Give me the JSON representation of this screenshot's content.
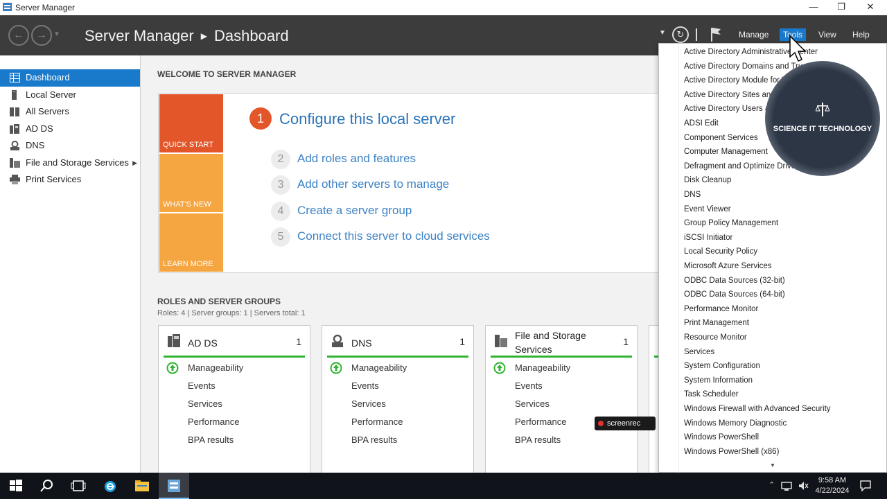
{
  "window": {
    "title": "Server Manager",
    "minimize_icon": "minimize-icon",
    "maximize_icon": "restore-icon",
    "close_icon": "close-icon"
  },
  "header": {
    "app_name": "Server Manager",
    "page": "Dashboard",
    "menus": [
      "Manage",
      "Tools",
      "View",
      "Help"
    ],
    "active_menu": "Tools"
  },
  "sidebar": {
    "items": [
      {
        "label": "Dashboard",
        "icon": "dashboard-icon"
      },
      {
        "label": "Local Server",
        "icon": "server-icon"
      },
      {
        "label": "All Servers",
        "icon": "servers-icon"
      },
      {
        "label": "AD DS",
        "icon": "adds-icon"
      },
      {
        "label": "DNS",
        "icon": "dns-icon"
      },
      {
        "label": "File and Storage Services",
        "icon": "storage-icon"
      },
      {
        "label": "Print Services",
        "icon": "printer-icon"
      }
    ],
    "active": "Dashboard"
  },
  "welcome": {
    "title": "WELCOME TO SERVER MANAGER",
    "tiles": [
      "QUICK START",
      "WHAT'S NEW",
      "LEARN MORE"
    ],
    "step1": {
      "num": "1",
      "text": "Configure this local server"
    },
    "steps": [
      {
        "num": "2",
        "text": "Add roles and features"
      },
      {
        "num": "3",
        "text": "Add other servers to manage"
      },
      {
        "num": "4",
        "text": "Create a server group"
      },
      {
        "num": "5",
        "text": "Connect this server to cloud services"
      }
    ]
  },
  "roles": {
    "title": "ROLES AND SERVER GROUPS",
    "summary": "Roles: 4   |   Server groups: 1   |   Servers total: 1",
    "cards": [
      {
        "name": "AD DS",
        "count": "1",
        "rows": [
          "Manageability",
          "Events",
          "Services",
          "Performance",
          "BPA results"
        ]
      },
      {
        "name": "DNS",
        "count": "1",
        "rows": [
          "Manageability",
          "Events",
          "Services",
          "Performance",
          "BPA results"
        ]
      },
      {
        "name": "File and Storage Services",
        "count": "1",
        "rows": [
          "Manageability",
          "Events",
          "Services",
          "Performance",
          "BPA results"
        ]
      }
    ]
  },
  "tools_menu": {
    "items": [
      "Active Directory Administrative Center",
      "Active Directory Domains and Trusts",
      "Active Directory Module for Windows PowerShell",
      "Active Directory Sites and Services",
      "Active Directory Users and Computers",
      "ADSI Edit",
      "Component Services",
      "Computer Management",
      "Defragment and Optimize Drives",
      "Disk Cleanup",
      "DNS",
      "Event Viewer",
      "Group Policy Management",
      "iSCSI Initiator",
      "Local Security Policy",
      "Microsoft Azure Services",
      "ODBC Data Sources (32-bit)",
      "ODBC Data Sources (64-bit)",
      "Performance Monitor",
      "Print Management",
      "Resource Monitor",
      "Services",
      "System Configuration",
      "System Information",
      "Task Scheduler",
      "Windows Firewall with Advanced Security",
      "Windows Memory Diagnostic",
      "Windows PowerShell",
      "Windows PowerShell (x86)"
    ],
    "more_icon": "scroll-down-icon"
  },
  "watermark": {
    "text": "SCIENCE IT TECHNOLOGY"
  },
  "recorder": {
    "text": "screenrec"
  },
  "taskbar": {
    "time": "9:58 AM",
    "date": "4/22/2024"
  },
  "colors": {
    "accent": "#1979ca",
    "header_bg": "#3c3c3c",
    "quickstart": "#e2562a",
    "tile": "#f5a641",
    "status_ok": "#2fb331",
    "link": "#3d82c4"
  }
}
